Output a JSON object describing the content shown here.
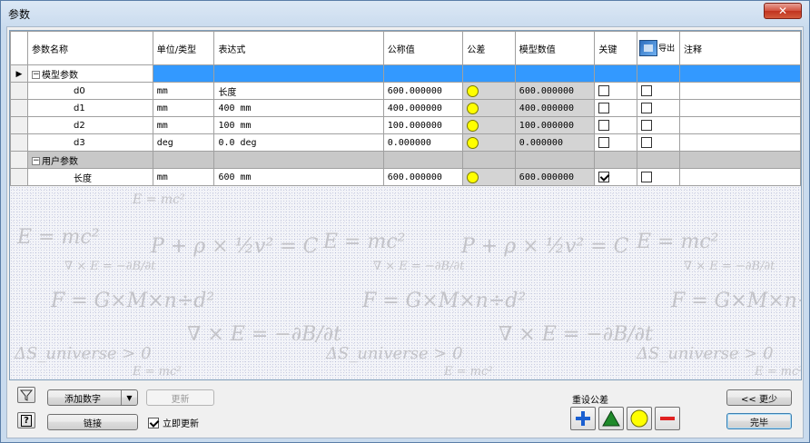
{
  "window": {
    "title": "参数",
    "close_glyph": "✕"
  },
  "table": {
    "headers": {
      "name": "参数名称",
      "unit": "单位/类型",
      "expression": "表达式",
      "nominal": "公称值",
      "tolerance": "公差",
      "model_value": "模型数值",
      "key": "关键",
      "export": "导出",
      "comment": "注释"
    },
    "groups": [
      {
        "label": "模型参数",
        "rows": [
          {
            "name": "d0",
            "unit": "mm",
            "expression": "长度",
            "nominal": "600.000000",
            "model_value": "600.000000",
            "key": false,
            "export": false
          },
          {
            "name": "d1",
            "unit": "mm",
            "expression": "400 mm",
            "nominal": "400.000000",
            "model_value": "400.000000",
            "key": false,
            "export": false
          },
          {
            "name": "d2",
            "unit": "mm",
            "expression": "100 mm",
            "nominal": "100.000000",
            "model_value": "100.000000",
            "key": false,
            "export": false
          },
          {
            "name": "d3",
            "unit": "deg",
            "expression": "0.0 deg",
            "nominal": "0.000000",
            "model_value": "0.000000",
            "key": false,
            "export": false
          }
        ]
      },
      {
        "label": "用户参数",
        "rows": [
          {
            "name": "长度",
            "unit": "mm",
            "expression": "600 mm",
            "nominal": "600.000000",
            "model_value": "600.000000",
            "key": true,
            "export": false
          }
        ]
      }
    ]
  },
  "formulas": {
    "emc2": "E = mc²",
    "bernoulli": "P + ρ × ½v² = C",
    "maxwell": "∇ × E = −∂B/∂t",
    "gravity": "F = G×M×n÷d²",
    "entropy": "ΔS_universe > 0"
  },
  "toolbar": {
    "filter_icon": "filter-icon",
    "help_label": "?",
    "add_number": "添加数字",
    "update": "更新",
    "link": "链接",
    "immediate_update": "立即更新",
    "immediate_update_checked": true,
    "reset_tolerance": "重设公差",
    "less": "<< 更少",
    "done": "完毕"
  },
  "colors": {
    "selection": "#3399ff",
    "group_user": "#c8c8c8",
    "tol_plus": "#1a5fd0",
    "tol_triangle": "#1f8a2a",
    "tol_circle": "#ffff00",
    "tol_minus": "#e02020"
  }
}
